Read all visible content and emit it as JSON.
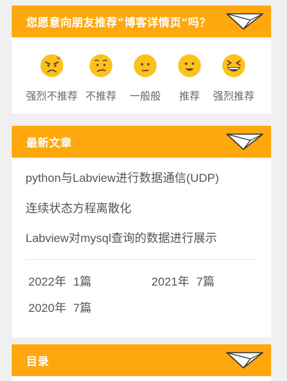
{
  "recommend": {
    "title": "您愿意向朋友推荐“博客详情页”吗？",
    "options": [
      {
        "label": "强烈不推荐",
        "icon": "angry-face-icon"
      },
      {
        "label": "不推荐",
        "icon": "confused-face-icon"
      },
      {
        "label": "一般般",
        "icon": "neutral-face-icon"
      },
      {
        "label": "推荐",
        "icon": "smiling-face-icon"
      },
      {
        "label": "强烈推荐",
        "icon": "grinning-squint-face-icon"
      }
    ]
  },
  "articles": {
    "title": "最新文章",
    "items": [
      "python与Labview进行数据通信(UDP)",
      "连续状态方程离散化",
      "Labview对mysql查询的数据进行展示"
    ],
    "archives": [
      {
        "year": "2022年",
        "count": "1篇"
      },
      {
        "year": "2021年",
        "count": "7篇"
      },
      {
        "year": "2020年",
        "count": "7篇"
      }
    ]
  },
  "toc": {
    "title": "目录"
  },
  "colors": {
    "accent": "#fea80d",
    "emoji": "#fcc21b",
    "text": "#555555"
  }
}
